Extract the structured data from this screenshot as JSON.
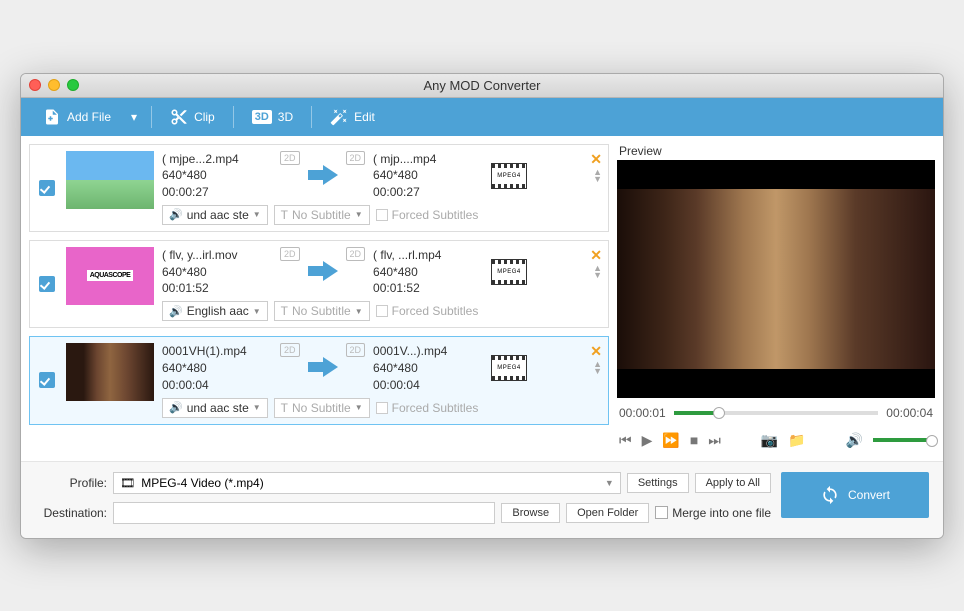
{
  "window": {
    "title": "Any MOD Converter"
  },
  "toolbar": {
    "addFile": "Add File",
    "clip": "Clip",
    "threeD": "3D",
    "edit": "Edit"
  },
  "items": [
    {
      "checked": true,
      "source": {
        "name": "( mjpe...2.mp4",
        "resolution": "640*480",
        "duration": "00:00:27"
      },
      "target": {
        "name": "( mjp....mp4",
        "resolution": "640*480",
        "duration": "00:00:27"
      },
      "audio": "und aac ste",
      "subtitle": "No Subtitle",
      "forced": "Forced Subtitles",
      "selected": false
    },
    {
      "checked": true,
      "source": {
        "name": "( flv, y...irl.mov",
        "resolution": "640*480",
        "duration": "00:01:52"
      },
      "target": {
        "name": "( flv, ...rl.mp4",
        "resolution": "640*480",
        "duration": "00:01:52"
      },
      "audio": "English aac",
      "subtitle": "No Subtitle",
      "forced": "Forced Subtitles",
      "selected": false
    },
    {
      "checked": true,
      "source": {
        "name": "0001VH(1).mp4",
        "resolution": "640*480",
        "duration": "00:00:04"
      },
      "target": {
        "name": "0001V...).mp4",
        "resolution": "640*480",
        "duration": "00:00:04"
      },
      "audio": "und aac ste",
      "subtitle": "No Subtitle",
      "forced": "Forced Subtitles",
      "selected": true
    }
  ],
  "preview": {
    "label": "Preview",
    "current": "00:00:01",
    "total": "00:00:04"
  },
  "bottom": {
    "profileLabel": "Profile:",
    "profileValue": "MPEG-4 Video (*.mp4)",
    "settings": "Settings",
    "applyAll": "Apply to All",
    "destLabel": "Destination:",
    "destValue": "",
    "browse": "Browse",
    "openFolder": "Open Folder",
    "merge": "Merge into one file",
    "convert": "Convert"
  },
  "badge2d": "2D",
  "fmtLabel": "MPEG4"
}
